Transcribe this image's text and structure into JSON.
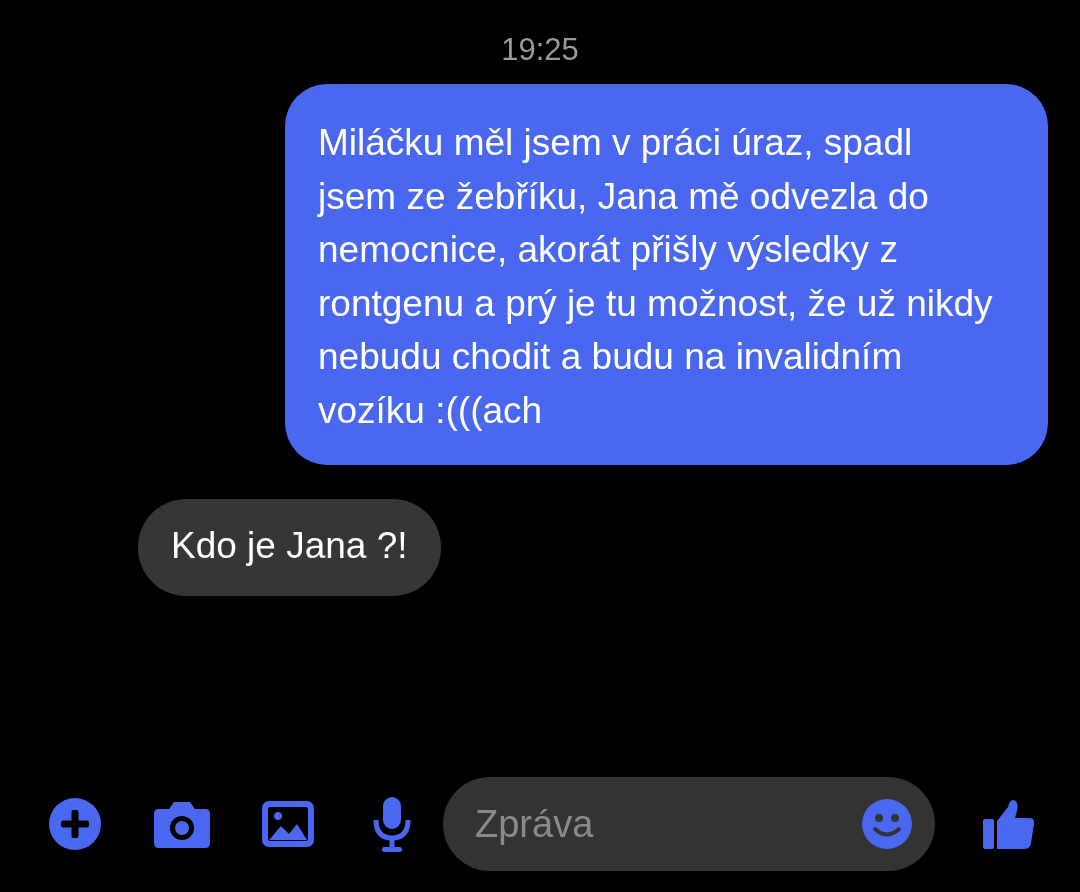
{
  "timestamp": "19:25",
  "messages": [
    {
      "kind": "outgoing",
      "text": "Miláčku měl jsem v práci úraz, spadl jsem ze žebříku, Jana mě odvezla do nemocnice, akorát přišly výsledky z rontgenu a prý je tu možnost, že už nikdy nebudu chodit a budu na invalidním vozíku :(((ach"
    },
    {
      "kind": "incoming",
      "text": "Kdo je Jana ?!"
    }
  ],
  "composer": {
    "placeholder": "Zpráva"
  }
}
